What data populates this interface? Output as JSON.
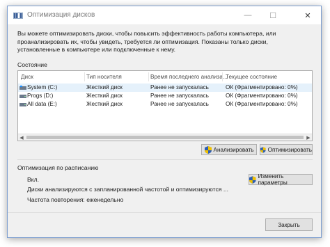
{
  "window": {
    "title": "Оптимизация дисков",
    "minimize_glyph": "—",
    "maximize_glyph": "☐",
    "close_glyph": "✕"
  },
  "description": "Вы можете оптимизировать диски, чтобы повысить эффективность работы  компьютера, или проанализировать их, чтобы увидеть, требуется ли оптимизация. Показаны только диски, установленные в компьютере или подключенные к нему.",
  "status": {
    "label": "Состояние",
    "columns": [
      "Диск",
      "Тип носителя",
      "Время последнего анализа...",
      "Текущее состояние"
    ],
    "rows": [
      {
        "disk": "System (C:)",
        "media": "Жесткий диск",
        "last": "Ранее не запускалась",
        "state": "ОК (Фрагментировано: 0%)",
        "icon": "windows-drive-icon"
      },
      {
        "disk": "Progs (D:)",
        "media": "Жесткий диск",
        "last": "Ранее не запускалась",
        "state": "ОК (Фрагментировано: 0%)",
        "icon": "drive-icon"
      },
      {
        "disk": "All data (E:)",
        "media": "Жесткий диск",
        "last": "Ранее не запускалась",
        "state": "ОК (Фрагментировано: 0%)",
        "icon": "drive-icon"
      }
    ],
    "selected_row": 0,
    "analyze_button": "Анализировать",
    "optimize_button": "Оптимизировать"
  },
  "schedule": {
    "label": "Оптимизация по расписанию",
    "state": "Вкл.",
    "details": "Диски анализируются с запланированной частотой и оптимизируются ...",
    "frequency": "Частота повторения: еженедельно",
    "change_button": "Изменить параметры"
  },
  "footer": {
    "close_button": "Закрыть"
  },
  "colors": {
    "selection": "#e5f1fb",
    "window_border": "#7a9ccf",
    "shield_blue": "#2f5fb3",
    "shield_yellow": "#f2c200"
  }
}
